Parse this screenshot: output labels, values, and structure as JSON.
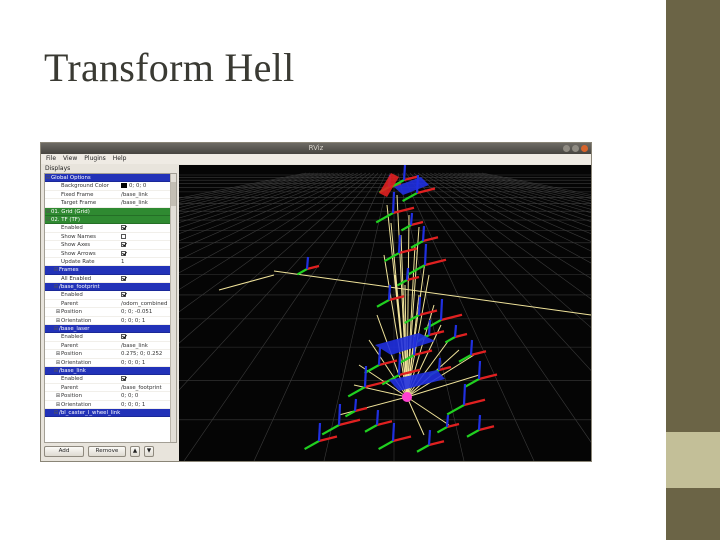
{
  "slide": {
    "title": "Transform Hell"
  },
  "window": {
    "title": "RViz",
    "menu": [
      "File",
      "View",
      "Plugins",
      "Help"
    ]
  },
  "displays": {
    "label": "Displays",
    "rows": [
      {
        "k": "Global Options",
        "v": "",
        "style": "blue",
        "exp": "⊟"
      },
      {
        "k": "Background Color",
        "v": "0; 0; 0",
        "style": "",
        "exp": "",
        "swatch": true
      },
      {
        "k": "Fixed Frame",
        "v": "/base_link",
        "style": "",
        "exp": ""
      },
      {
        "k": "Target Frame",
        "v": "/base_link",
        "style": "",
        "exp": ""
      },
      {
        "k": "01. Grid (Grid)",
        "v": "",
        "style": "green",
        "exp": "⊞"
      },
      {
        "k": "02. TF (TF)",
        "v": "",
        "style": "green",
        "exp": "⊟"
      },
      {
        "k": "Enabled",
        "v": "",
        "style": "",
        "exp": "",
        "check": true
      },
      {
        "k": "Show Names",
        "v": "",
        "style": "",
        "exp": "",
        "check": false
      },
      {
        "k": "Show Axes",
        "v": "",
        "style": "",
        "exp": "",
        "check": true
      },
      {
        "k": "Show Arrows",
        "v": "",
        "style": "",
        "exp": "",
        "check": true
      },
      {
        "k": "Update Rate",
        "v": "1",
        "style": "",
        "exp": ""
      },
      {
        "k": "Frames",
        "v": "",
        "style": "blue",
        "exp": "⊟"
      },
      {
        "k": "All Enabled",
        "v": "",
        "style": "",
        "exp": "",
        "check": true
      },
      {
        "k": "/base_footprint",
        "v": "",
        "style": "blue",
        "exp": "⊟"
      },
      {
        "k": "Enabled",
        "v": "",
        "style": "",
        "exp": "",
        "check": true
      },
      {
        "k": "Parent",
        "v": "/odom_combined",
        "style": "",
        "exp": ""
      },
      {
        "k": "Position",
        "v": "0; 0; -0.051",
        "style": "",
        "exp": "⊞"
      },
      {
        "k": "Orientation",
        "v": "0; 0; 0; 1",
        "style": "",
        "exp": "⊞"
      },
      {
        "k": "/base_laser",
        "v": "",
        "style": "blue",
        "exp": "⊟"
      },
      {
        "k": "Enabled",
        "v": "",
        "style": "",
        "exp": "",
        "check": true
      },
      {
        "k": "Parent",
        "v": "/base_link",
        "style": "",
        "exp": ""
      },
      {
        "k": "Position",
        "v": "0.275; 0; 0.252",
        "style": "",
        "exp": "⊞"
      },
      {
        "k": "Orientation",
        "v": "0; 0; 0; 1",
        "style": "",
        "exp": "⊞"
      },
      {
        "k": "/base_link",
        "v": "",
        "style": "blue",
        "exp": "⊟"
      },
      {
        "k": "Enabled",
        "v": "",
        "style": "",
        "exp": "",
        "check": true
      },
      {
        "k": "Parent",
        "v": "/base_footprint",
        "style": "",
        "exp": ""
      },
      {
        "k": "Position",
        "v": "0; 0; 0",
        "style": "",
        "exp": "⊞"
      },
      {
        "k": "Orientation",
        "v": "0; 0; 0; 1",
        "style": "",
        "exp": "⊞"
      },
      {
        "k": "/bl_caster_l_wheel_link",
        "v": "",
        "style": "blue",
        "exp": "⊟"
      }
    ],
    "add_label": "Add",
    "remove_label": "Remove",
    "up_label": "▲",
    "down_label": "▼"
  },
  "colors": {
    "slide_bar": "#6b6446",
    "slide_accent": "#c3bf98",
    "row_blue": "#2232b8",
    "row_green": "#2f8a31",
    "tf_x_axis": "#e02020",
    "tf_y_axis": "#20d020",
    "tf_z_axis": "#2030e0",
    "tf_link": "#f0e39a",
    "tf_origin": "#ff40d0"
  }
}
